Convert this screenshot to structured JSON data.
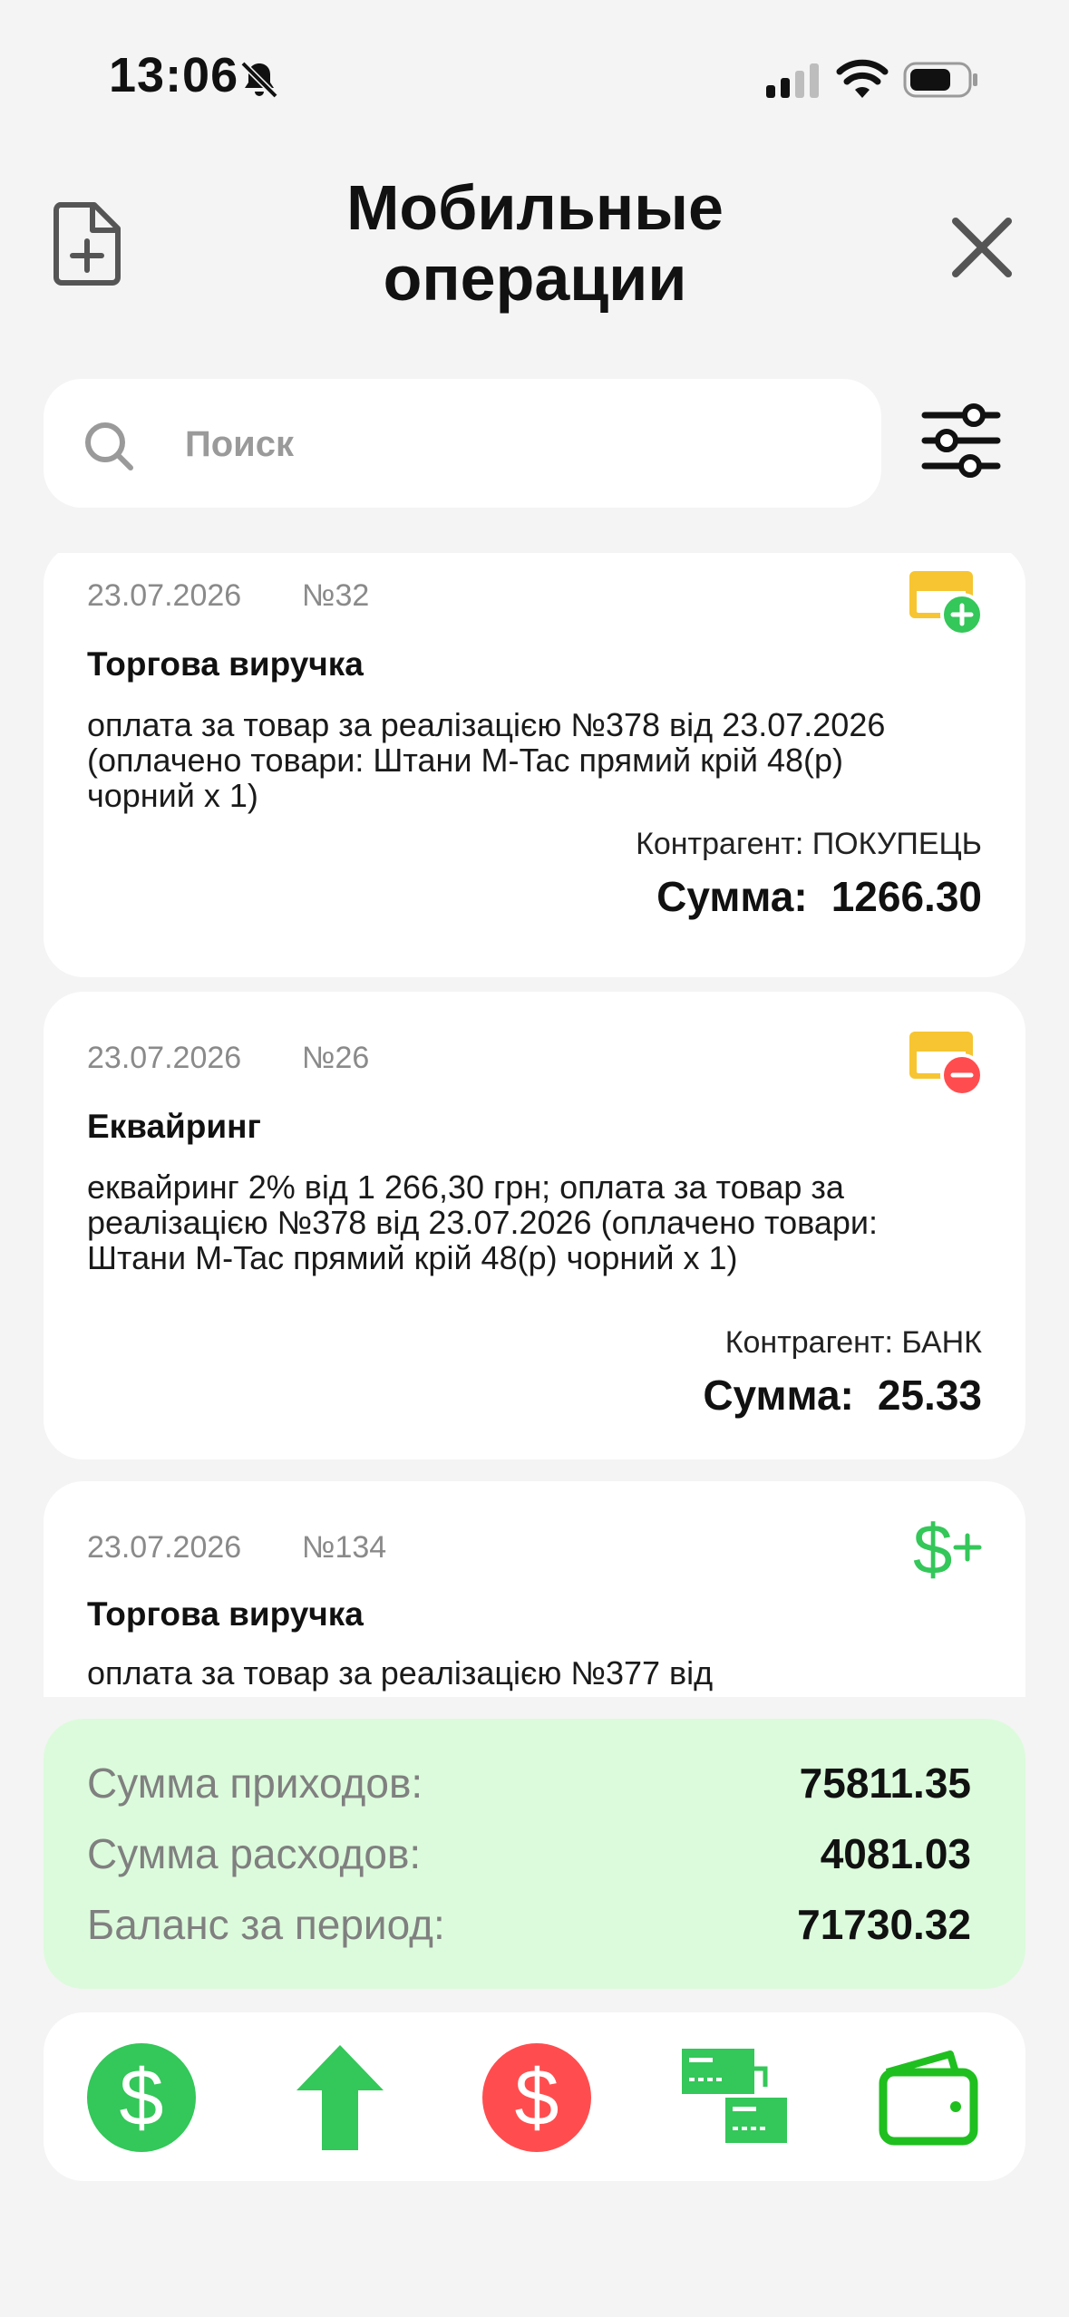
{
  "status_bar": {
    "time": "13:06"
  },
  "header": {
    "title_line1": "Мобильные",
    "title_line2": "операции"
  },
  "search": {
    "placeholder": "Поиск"
  },
  "operations": [
    {
      "date": "23.07.2026",
      "number": "№32",
      "title": "Торгова виручка",
      "description": "оплата за товар за реалізацією №378 від 23.07.2026 (оплачено товари: Штани M-Tac прямий крій 48(р) чорний x 1)",
      "counterparty": "Контрагент: ПОКУПЕЦЬ",
      "sum_label": "Сумма:",
      "sum_value": "1266.30",
      "icon": "card-plus-icon"
    },
    {
      "date": "23.07.2026",
      "number": "№26",
      "title": "Еквайринг",
      "description": "еквайринг 2% від 1 266,30 грн; оплата за товар за реалізацією №378 від 23.07.2026 (оплачено товари: Штани M-Tac прямий крій 48(р) чорний x 1)",
      "counterparty": "Контрагент: БАНК",
      "sum_label": "Сумма:",
      "sum_value": "25.33",
      "icon": "card-minus-icon"
    },
    {
      "date": "23.07.2026",
      "number": "№134",
      "title": "Торгова виручка",
      "description": "оплата за товар за реалізацією №377 від",
      "icon": "dollar-plus-icon"
    }
  ],
  "totals": {
    "income_label": "Сумма приходов:",
    "income_value": "75811.35",
    "expense_label": "Сумма расходов:",
    "expense_value": "4081.03",
    "balance_label": "Баланс за период:",
    "balance_value": "71730.32"
  },
  "bottom_bar": {
    "buttons": [
      "income-dollar-icon",
      "upload-arrow-icon",
      "expense-dollar-icon",
      "transfer-icon",
      "wallet-icon"
    ]
  },
  "colors": {
    "green": "#34c759",
    "red": "#ff4d4f",
    "yellow": "#f6c531",
    "totals_bg": "#dcfbdc",
    "bg": "#f4f4f4"
  }
}
